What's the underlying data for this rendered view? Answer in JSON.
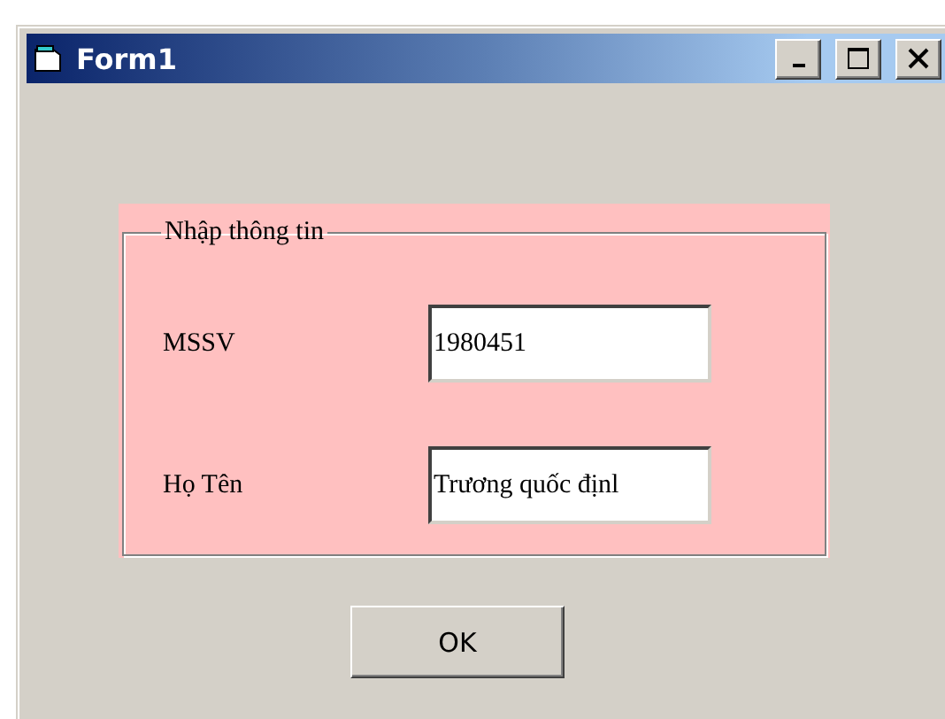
{
  "window": {
    "title": "Form1"
  },
  "group": {
    "title": "Nhập thông tin",
    "fields": [
      {
        "label": "MSSV",
        "value": "1980451"
      },
      {
        "label": "Họ Tên",
        "value": "Trương quốc địnl"
      }
    ]
  },
  "buttons": [
    "OK"
  ]
}
